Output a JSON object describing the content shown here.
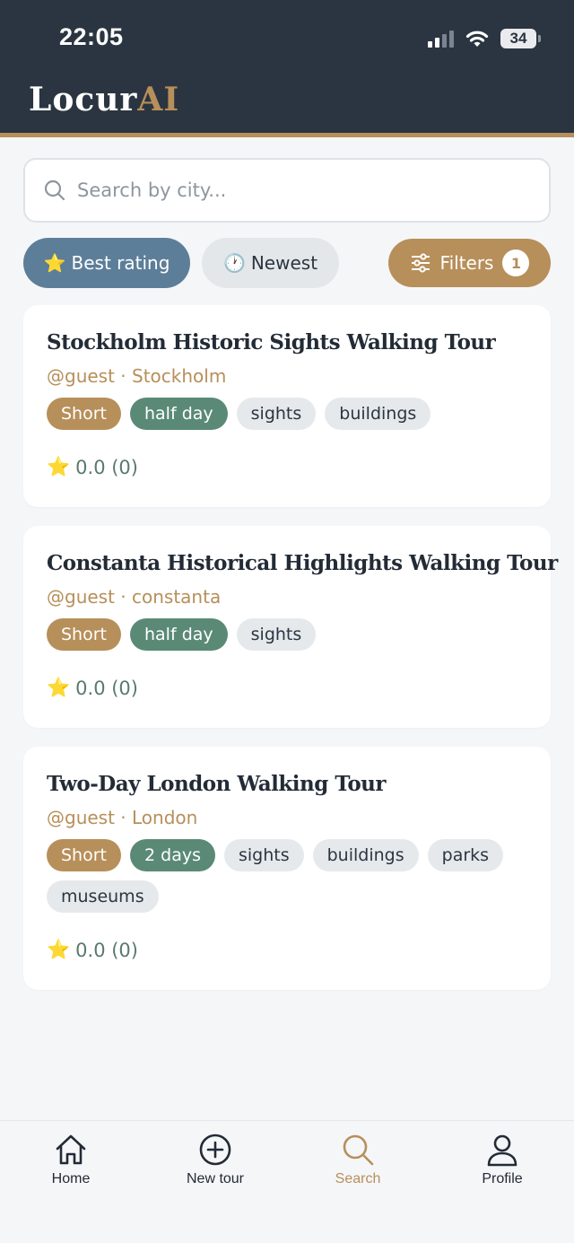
{
  "status_bar": {
    "time": "22:05",
    "battery": "34"
  },
  "brand": {
    "part1": "Locur",
    "part2": "AI"
  },
  "search": {
    "placeholder": "Search by city..."
  },
  "sort_chips": {
    "best_rating": {
      "emoji": "⭐",
      "label": "Best rating"
    },
    "newest": {
      "emoji": "🕐",
      "label": "Newest"
    }
  },
  "filters": {
    "label": "Filters",
    "count": "1"
  },
  "tours": [
    {
      "title": "Stockholm Historic Sights Walking Tour",
      "meta": "@guest · Stockholm",
      "tags": [
        "Short",
        "half day",
        "sights",
        "buildings"
      ],
      "rating_star": "⭐",
      "rating": "0.0 (0)"
    },
    {
      "title": "Constanta Historical Highlights Walking Tour",
      "meta": "@guest · constanta",
      "tags": [
        "Short",
        "half day",
        "sights"
      ],
      "rating_star": "⭐",
      "rating": "0.0 (0)"
    },
    {
      "title": "Two-Day London Walking Tour",
      "meta": "@guest · London",
      "tags": [
        "Short",
        "2 days",
        "sights",
        "buildings",
        "parks",
        "museums"
      ],
      "rating_star": "⭐",
      "rating": "0.0 (0)"
    }
  ],
  "nav": {
    "home": "Home",
    "new_tour": "New tour",
    "search": "Search",
    "profile": "Profile"
  },
  "colors": {
    "header_bg": "#2b3541",
    "accent_gold": "#b78f5a",
    "chip_blue": "#5d7e98",
    "tag_green": "#5a8a76"
  }
}
